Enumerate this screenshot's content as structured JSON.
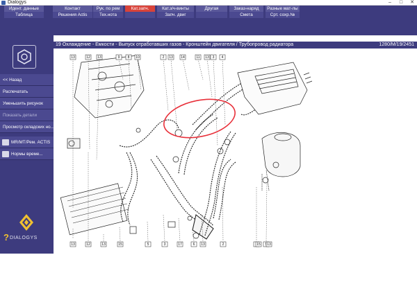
{
  "window": {
    "title": "Dialogys",
    "buttons": [
      "–",
      "□",
      "✕"
    ]
  },
  "topnav": {
    "row1": [
      "Идент. данные",
      "Контакт",
      "Рук. по рем",
      "Кат.запч.",
      "Кат.з/ч-винты",
      "Другая",
      "Заказ-наряд",
      "Разные мат-лы"
    ],
    "row2": [
      "Таблица",
      "Решения Actis",
      "Тех.нота",
      "",
      "Запч. двиг",
      "",
      "Смета",
      "Срт. сохр.№"
    ],
    "active_index": 3
  },
  "sidebar": {
    "logo_icon": "nut-icon",
    "buttons": [
      "<< Назад",
      "Распечатать",
      "Уменьшить рисунок",
      "Показать детали",
      "Просмотр складских но..."
    ],
    "dim_index": 3,
    "icon_items": [
      "MR/MT/Рем. ACTIS",
      "Нормы време..."
    ],
    "brand_text": "DIALOGYS"
  },
  "header": {
    "title": "19 Охлаждение - Емкости - Выпуск отработавших газов - Кронштейн двигателя / Трубопровод радиатора",
    "ref": "1280/M/19/2451"
  },
  "drawing": {
    "callouts_top": [
      "13",
      "12",
      "13",
      "9",
      "8",
      "10",
      "2",
      "13",
      "14",
      "11",
      "13",
      "3",
      "4"
    ],
    "callouts_bottom": [
      "13",
      "12",
      "13",
      "15",
      "5",
      "3",
      "17",
      "6",
      "13",
      "2",
      "4",
      "9",
      "15",
      "13"
    ],
    "highlight_color": "#e8303a"
  }
}
